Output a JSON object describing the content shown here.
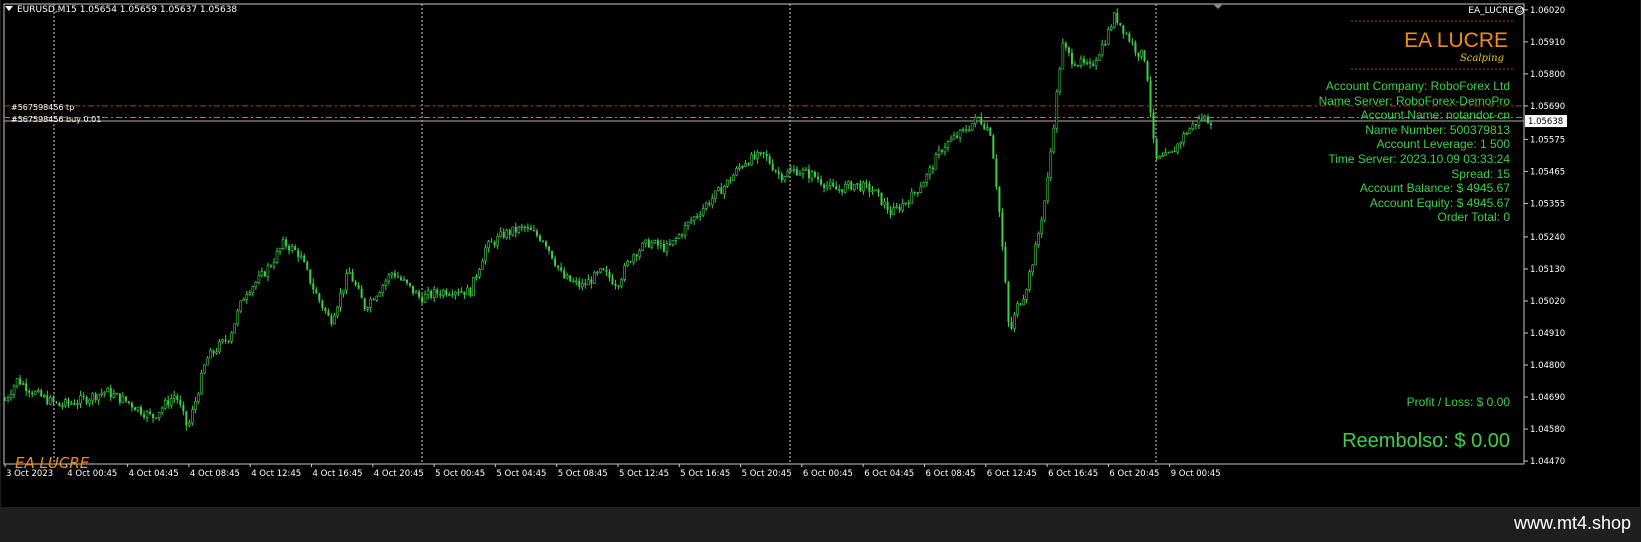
{
  "header": {
    "symbol_info": "EURUSD,M15  1.05654 1.05659 1.05637 1.05638",
    "ea_name": "EA_LUCRE"
  },
  "panel": {
    "brand": "EA LUCRE",
    "subtitle": "Scalping",
    "lines": [
      "Account Company: RoboForex Ltd",
      "Name Server: RoboForex-DemoPro",
      "Account Name: notandor-cn",
      "Name Number: 500379813",
      "Account Leverage: 1 500",
      "Time Server: 2023.10.09 03:33:24",
      "Spread: 15",
      "Account Balance: $ 4945.67",
      "Account Equity: $ 4945.67",
      "Order Total: 0"
    ],
    "profit_loss": "Profit / Loss: $ 0.00",
    "reembolso": "Reembolso: $ 0.00"
  },
  "watermark": "EA LUCRE",
  "orders": {
    "tp_label": "#567598456 tp",
    "buy_label": "#567598456 buy 0.01"
  },
  "footer": {
    "url": "www.mt4.shop"
  },
  "colors": {
    "candle": "#3cd048",
    "brand": "#f08c1c",
    "tp_line": "#c0302a",
    "buy_line": "#3cb050"
  },
  "chart_data": {
    "type": "candlestick",
    "current_price": "1.05638",
    "y_ticks": [
      "1.06020",
      "1.05910",
      "1.05800",
      "1.05690",
      "1.05575",
      "1.05465",
      "1.05355",
      "1.05240",
      "1.05130",
      "1.05020",
      "1.04910",
      "1.04800",
      "1.04690",
      "1.04580",
      "1.04470"
    ],
    "x_ticks": [
      "3 Oct 2023",
      "4 Oct 00:45",
      "4 Oct 04:45",
      "4 Oct 08:45",
      "4 Oct 12:45",
      "4 Oct 16:45",
      "4 Oct 20:45",
      "5 Oct 00:45",
      "5 Oct 04:45",
      "5 Oct 08:45",
      "5 Oct 12:45",
      "5 Oct 16:45",
      "5 Oct 20:45",
      "6 Oct 00:45",
      "6 Oct 04:45",
      "6 Oct 08:45",
      "6 Oct 12:45",
      "6 Oct 16:45",
      "6 Oct 20:45",
      "9 Oct 00:45"
    ],
    "ylim": [
      1.0446,
      1.0604
    ],
    "tp_price": 1.0569,
    "buy_price": 1.0565,
    "price_path": [
      [
        0,
        1.0468
      ],
      [
        0.008,
        1.0475
      ],
      [
        0.02,
        1.047
      ],
      [
        0.035,
        1.0466
      ],
      [
        0.05,
        1.0468
      ],
      [
        0.065,
        1.0471
      ],
      [
        0.08,
        1.0467
      ],
      [
        0.095,
        1.0462
      ],
      [
        0.11,
        1.047
      ],
      [
        0.118,
        1.0458
      ],
      [
        0.13,
        1.0482
      ],
      [
        0.145,
        1.049
      ],
      [
        0.155,
        1.0505
      ],
      [
        0.165,
        1.051
      ],
      [
        0.172,
        1.0515
      ],
      [
        0.18,
        1.0522
      ],
      [
        0.19,
        1.0518
      ],
      [
        0.2,
        1.0505
      ],
      [
        0.21,
        1.0495
      ],
      [
        0.222,
        1.0512
      ],
      [
        0.232,
        1.05
      ],
      [
        0.24,
        1.0505
      ],
      [
        0.25,
        1.0512
      ],
      [
        0.258,
        1.0508
      ],
      [
        0.268,
        1.0503
      ],
      [
        0.28,
        1.0505
      ],
      [
        0.29,
        1.0506
      ],
      [
        0.3,
        1.0505
      ],
      [
        0.31,
        1.052
      ],
      [
        0.322,
        1.0525
      ],
      [
        0.335,
        1.0527
      ],
      [
        0.348,
        1.0523
      ],
      [
        0.36,
        1.051
      ],
      [
        0.372,
        1.0507
      ],
      [
        0.385,
        1.0512
      ],
      [
        0.395,
        1.0508
      ],
      [
        0.405,
        1.0518
      ],
      [
        0.415,
        1.0522
      ],
      [
        0.428,
        1.052
      ],
      [
        0.44,
        1.0528
      ],
      [
        0.452,
        1.0535
      ],
      [
        0.465,
        1.0542
      ],
      [
        0.477,
        1.055
      ],
      [
        0.49,
        1.0552
      ],
      [
        0.5,
        1.0545
      ],
      [
        0.51,
        1.0547
      ],
      [
        0.522,
        1.0545
      ],
      [
        0.535,
        1.054
      ],
      [
        0.548,
        1.0542
      ],
      [
        0.56,
        1.054
      ],
      [
        0.572,
        1.0532
      ],
      [
        0.585,
        1.0538
      ],
      [
        0.595,
        1.0545
      ],
      [
        0.605,
        1.0555
      ],
      [
        0.618,
        1.056
      ],
      [
        0.628,
        1.0565
      ],
      [
        0.636,
        1.056
      ],
      [
        0.642,
        1.053
      ],
      [
        0.648,
        1.049
      ],
      [
        0.653,
        1.05
      ],
      [
        0.658,
        1.0505
      ],
      [
        0.665,
        1.052
      ],
      [
        0.672,
        1.054
      ],
      [
        0.678,
        1.057
      ],
      [
        0.682,
        1.059
      ],
      [
        0.688,
        1.0585
      ],
      [
        0.7,
        1.0582
      ],
      [
        0.71,
        1.0592
      ],
      [
        0.716,
        1.06
      ],
      [
        0.722,
        1.0595
      ],
      [
        0.73,
        1.0588
      ],
      [
        0.736,
        1.0585
      ],
      [
        0.742,
        1.055
      ],
      [
        0.752,
        1.0552
      ],
      [
        0.762,
        1.056
      ],
      [
        0.772,
        1.0565
      ],
      [
        0.778,
        1.0564
      ]
    ]
  }
}
